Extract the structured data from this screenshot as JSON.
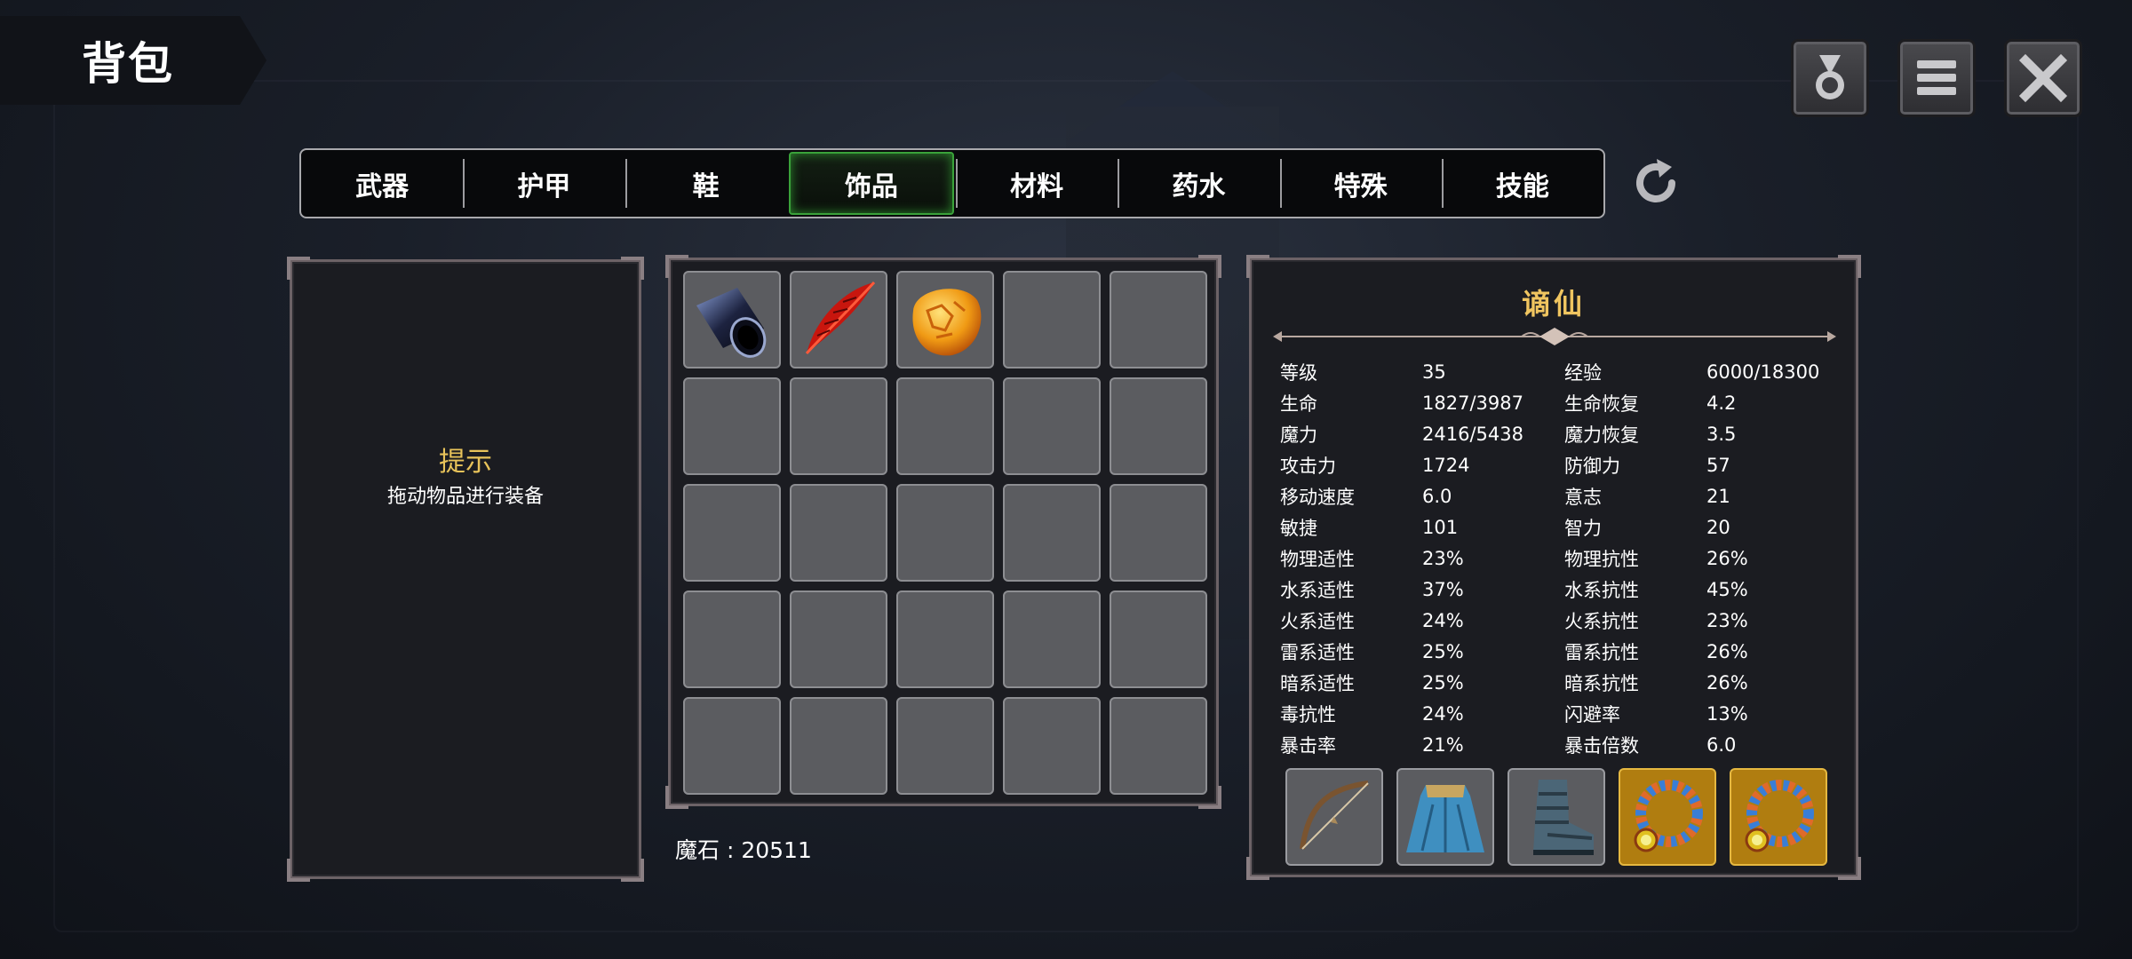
{
  "header": {
    "title": "背包"
  },
  "tabs": [
    {
      "label": "武器",
      "active": false
    },
    {
      "label": "护甲",
      "active": false
    },
    {
      "label": "鞋",
      "active": false
    },
    {
      "label": "饰品",
      "active": true
    },
    {
      "label": "材料",
      "active": false
    },
    {
      "label": "药水",
      "active": false
    },
    {
      "label": "特殊",
      "active": false
    },
    {
      "label": "技能",
      "active": false
    }
  ],
  "hint": {
    "title": "提示",
    "text": "拖动物品进行装备"
  },
  "inventory": {
    "slots": [
      {
        "item": "black-cylinder-icon"
      },
      {
        "item": "red-feather-icon"
      },
      {
        "item": "amber-stone-icon"
      },
      {},
      {},
      {},
      {},
      {},
      {},
      {},
      {},
      {},
      {},
      {},
      {},
      {},
      {},
      {},
      {},
      {},
      {},
      {},
      {},
      {},
      {}
    ]
  },
  "currency": {
    "label": "魔石",
    "separator": " : ",
    "value": "20511"
  },
  "character": {
    "name": "谪仙",
    "stats": [
      {
        "k1": "等级",
        "v1": "35",
        "k2": "经验",
        "v2": "6000/18300"
      },
      {
        "k1": "生命",
        "v1": "1827/3987",
        "k2": "生命恢复",
        "v2": "4.2"
      },
      {
        "k1": "魔力",
        "v1": "2416/5438",
        "k2": "魔力恢复",
        "v2": "3.5"
      },
      {
        "k1": "攻击力",
        "v1": "1724",
        "k2": "防御力",
        "v2": "57"
      },
      {
        "k1": "移动速度",
        "v1": "6.0",
        "k2": "意志",
        "v2": "21"
      },
      {
        "k1": "敏捷",
        "v1": "101",
        "k2": "智力",
        "v2": "20"
      },
      {
        "k1": "物理适性",
        "v1": "23%",
        "k2": "物理抗性",
        "v2": "26%"
      },
      {
        "k1": "水系适性",
        "v1": "37%",
        "k2": "水系抗性",
        "v2": "45%"
      },
      {
        "k1": "火系适性",
        "v1": "24%",
        "k2": "火系抗性",
        "v2": "23%"
      },
      {
        "k1": "雷系适性",
        "v1": "25%",
        "k2": "雷系抗性",
        "v2": "26%"
      },
      {
        "k1": "暗系适性",
        "v1": "25%",
        "k2": "暗系抗性",
        "v2": "26%"
      },
      {
        "k1": "毒抗性",
        "v1": "24%",
        "k2": "闪避率",
        "v2": "13%"
      },
      {
        "k1": "暴击率",
        "v1": "21%",
        "k2": "暴击倍数",
        "v2": "6.0"
      }
    ],
    "equipment": [
      {
        "item": "bow-icon",
        "rarity": "normal"
      },
      {
        "item": "cloak-armor-icon",
        "rarity": "normal"
      },
      {
        "item": "boot-icon",
        "rarity": "normal"
      },
      {
        "item": "necklace-icon",
        "rarity": "gold"
      },
      {
        "item": "necklace-icon",
        "rarity": "gold"
      }
    ]
  },
  "colors": {
    "accent_gold": "#f0c560",
    "active_tab": "#3aa23a",
    "gold_slot": "#b07d10"
  }
}
